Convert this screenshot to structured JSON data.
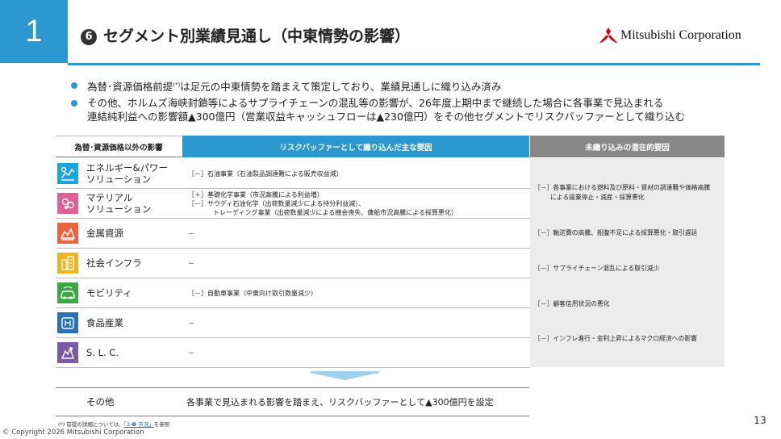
{
  "header": {
    "section_number": "1",
    "title_number": "6",
    "title": "セグメント別業績見通し（中東情勢の影響）",
    "company": "Mitsubishi Corporation"
  },
  "bullets": {
    "b1_pre": "為替･資源価格前提",
    "b1_sup": "(*)",
    "b1_post": "は足元の中東情勢を踏まえて策定しており、業績見通しに織り込み済み",
    "b2_line1": "その他、ホルムズ海峡封鎖等によるサプライチェーンの混乱等の影響が、26年度上期中まで継続した場合に各事業で見込まれる",
    "b2_line2": "連結純利益への影響額▲300億円（営業収益キャッシュフローは▲230億円）をその他セグメントでリスクバッファーとして織り込む"
  },
  "table": {
    "head_left": "為替･資源価格以外の影響",
    "head_mid": "リスクバッファーとして織り込んだ主な要因",
    "head_right": "未織り込みの潜在的要因",
    "rows": [
      {
        "name1": "エネルギー&パワー",
        "name2": "ソリューション",
        "d1": "［－］石油事業（石油製品調達難による販売収益減）",
        "d2": "",
        "d3": "",
        "icon": "energy-icon",
        "color": "#1aa5dd"
      },
      {
        "name1": "マテリアル",
        "name2": "ソリューション",
        "d1": "［＋］基礎化学事業（市況高騰による利益増）",
        "d2": "［－］サウディ石油化学（出荷数量減少による持分利益減）、",
        "d3": "トレーディング事業（出荷数量減少による機会喪失、傭船市況高騰による採算悪化）",
        "icon": "materials-icon",
        "color": "#e0609a"
      },
      {
        "name1": "金属資源",
        "name2": "",
        "d1": "－",
        "d2": "",
        "d3": "",
        "icon": "mineral-icon",
        "color": "#e8643c"
      },
      {
        "name1": "社会インフラ",
        "name2": "",
        "d1": "－",
        "d2": "",
        "d3": "",
        "icon": "infrastructure-icon",
        "color": "#f2b21d"
      },
      {
        "name1": "モビリティ",
        "name2": "",
        "d1": "［－］自動車事業（中東向け取引数量減少）",
        "d2": "",
        "d3": "",
        "icon": "mobility-icon",
        "color": "#3ca845"
      },
      {
        "name1": "食品産業",
        "name2": "",
        "d1": "－",
        "d2": "",
        "d3": "",
        "icon": "food-icon",
        "color": "#2a72b5"
      },
      {
        "name1": "S. L. C.",
        "name2": "",
        "d1": "－",
        "d2": "",
        "d3": "",
        "icon": "slc-icon",
        "color": "#7a5aa6"
      }
    ],
    "right_items": [
      {
        "l1": "［－］各事業における燃料及び原料・資材の調達難や価格高騰",
        "l2": "による操業停止・減産・採算悪化"
      },
      {
        "l1": "［－］輸送費の高騰、船腹不足による採算悪化・取引遅延",
        "l2": ""
      },
      {
        "l1": "［－］サプライチェーン混乱による取引減少",
        "l2": ""
      },
      {
        "l1": "［－］顧客信用状況の悪化",
        "l2": ""
      },
      {
        "l1": "［－］インフレ進行・金利上昇によるマクロ経済への影響",
        "l2": ""
      }
    ],
    "other_name": "その他",
    "other_text": "各事業で見込まれる影響を踏まえ、リスクバッファーとして▲300億円を設定"
  },
  "footer": {
    "footnote_pre": "(*) 前提の詳細については、",
    "footnote_link": "「3-❷ 市況」",
    "footnote_post": "を参照",
    "copyright": "© Copyright 2026 Mitsubishi Corporation",
    "page": "13"
  }
}
